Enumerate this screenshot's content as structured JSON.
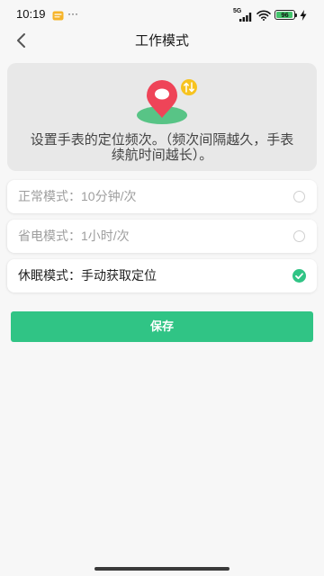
{
  "status_bar": {
    "time": "10:19",
    "notification_icon": "note-icon",
    "overflow": "···",
    "network_type": "5G",
    "signal_icon": "signal-bars-icon",
    "wifi_icon": "wifi-icon",
    "battery_level": "96",
    "charging_icon": "bolt-icon"
  },
  "header": {
    "back_icon": "chevron-left-icon",
    "title": "工作模式"
  },
  "info_card": {
    "illustration_icon": "location-pin-icon",
    "badge_icon": "up-down-arrows-icon",
    "description_lines": [
      "设置手表的定位频次。（频次间隔越久，手表",
      "续航时间越长）。"
    ]
  },
  "modes": [
    {
      "label": "正常模式：10分钟/次",
      "selected": false
    },
    {
      "label": "省电模式：1小时/次",
      "selected": false
    },
    {
      "label": "休眠模式：手动获取定位",
      "selected": true
    }
  ],
  "save_button": {
    "label": "保存"
  },
  "colors": {
    "page_bg": "#f7f7f7",
    "info_bg": "#e8e8e8",
    "card_bg": "#ffffff",
    "accent": "#30c485",
    "text_primary": "#222222",
    "text_secondary": "#444444",
    "text_muted": "#9e9e9e",
    "pin_red": "#ef4458",
    "pin_base": "#58c486",
    "badge_yellow": "#f7c31f",
    "battery_green": "#43c46c"
  }
}
